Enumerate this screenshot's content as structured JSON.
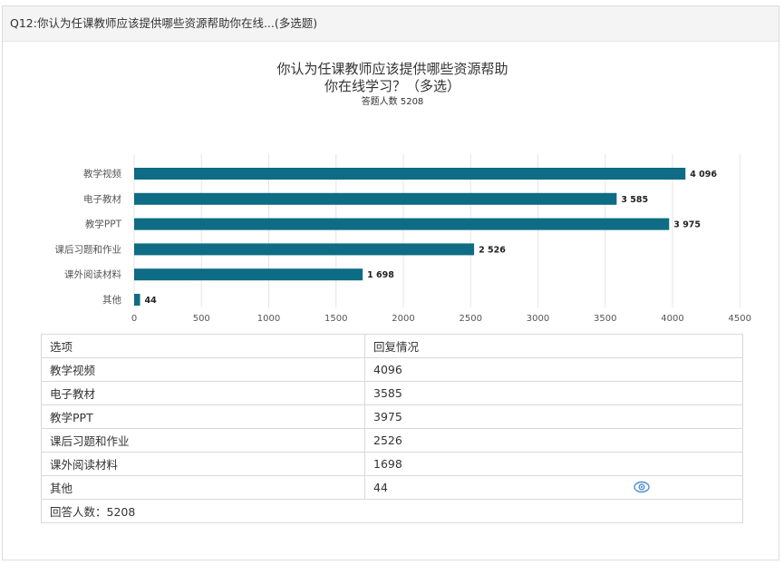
{
  "header": {
    "question": "Q12:你认为任课教师应该提供哪些资源帮助你在线...(多选题)"
  },
  "chart_data": {
    "type": "bar",
    "orientation": "horizontal",
    "title_line1": "你认为任课教师应该提供哪些资源帮助",
    "title_line2": "你在线学习？（多选）",
    "subtitle": "答题人数 5208",
    "categories": [
      "教学视频",
      "电子教材",
      "教学PPT",
      "课后习题和作业",
      "课外阅读材料",
      "其他"
    ],
    "values": [
      4096,
      3585,
      3975,
      2526,
      1698,
      44
    ],
    "value_labels": [
      "4 096",
      "3 585",
      "3 975",
      "2 526",
      "1 698",
      "44"
    ],
    "xlim": [
      0,
      4500
    ],
    "xticks": [
      0,
      500,
      1000,
      1500,
      2000,
      2500,
      3000,
      3500,
      4000,
      4500
    ],
    "bar_color": "#0e6c84",
    "grid": true
  },
  "table": {
    "headers": [
      "选项",
      "回复情况"
    ],
    "rows": [
      [
        "教学视频",
        "4096"
      ],
      [
        "电子教材",
        "3585"
      ],
      [
        "教学PPT",
        "3975"
      ],
      [
        "课后习题和作业",
        "2526"
      ],
      [
        "课外阅读材料",
        "1698"
      ],
      [
        "其他",
        "44"
      ]
    ],
    "footer": "回答人数：5208",
    "eye_icon": "eye-icon"
  }
}
